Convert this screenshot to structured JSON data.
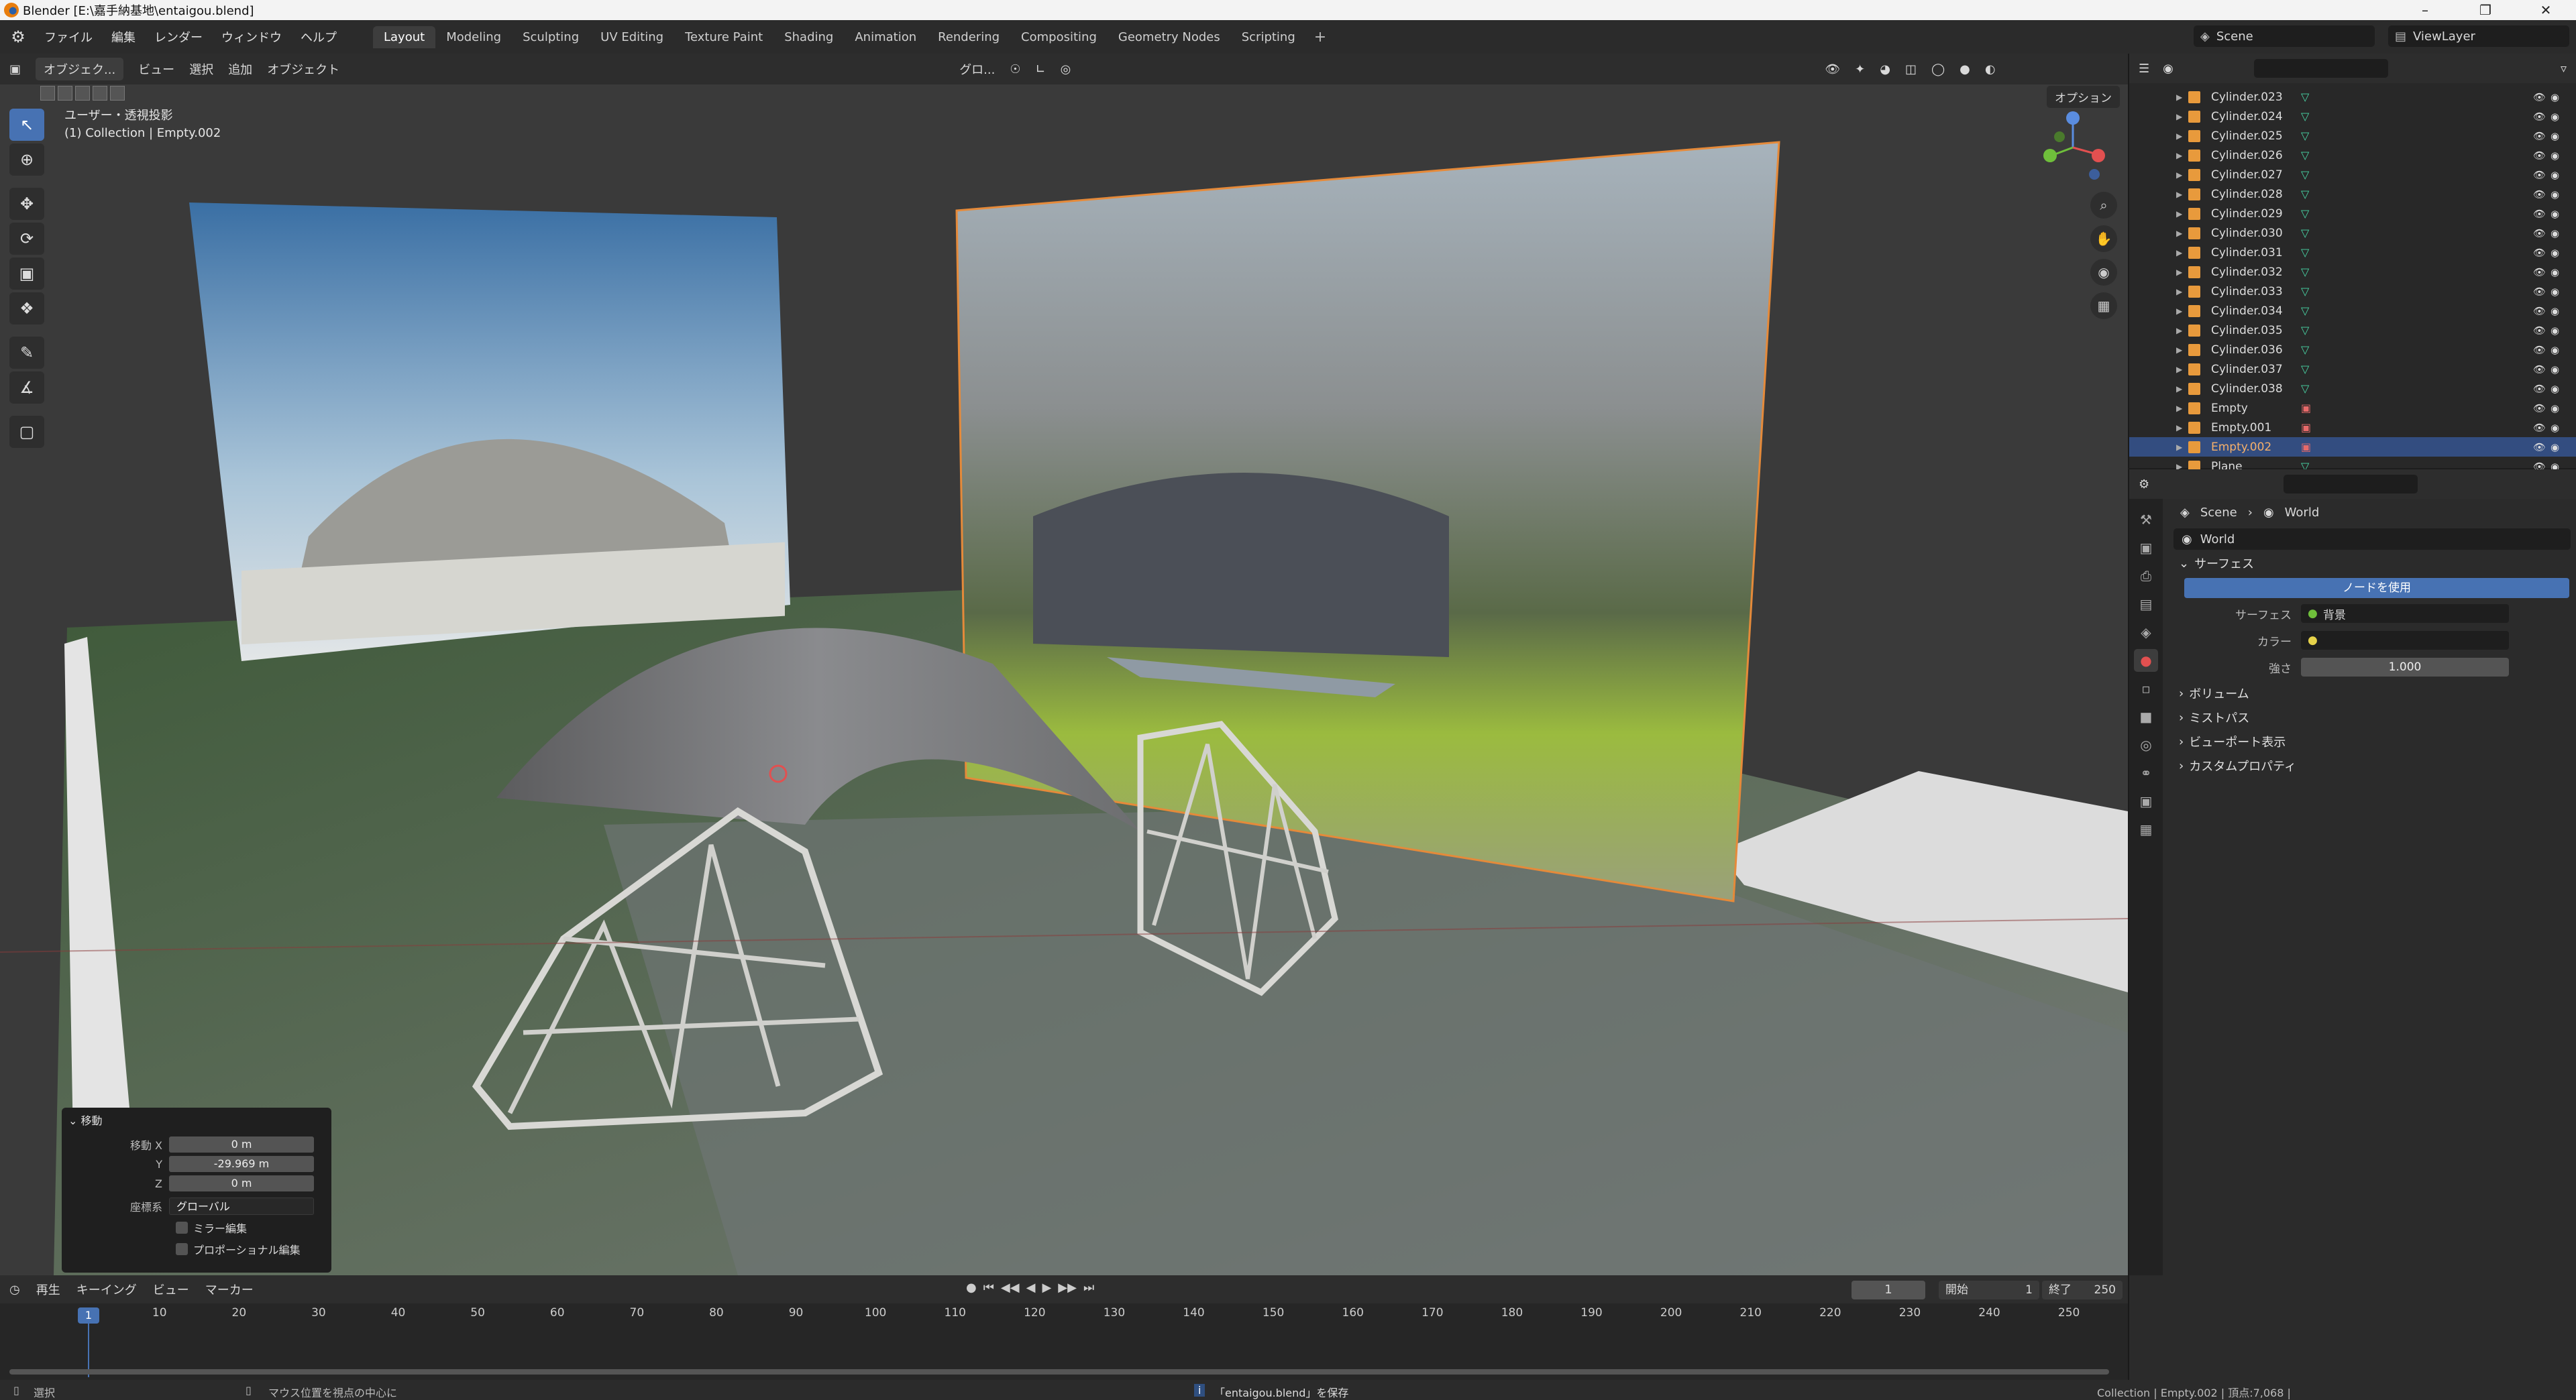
{
  "window": {
    "title": "Blender [E:\\嘉手納基地\\entaigou.blend]"
  },
  "topbar": {
    "menus": [
      "ファイル",
      "編集",
      "レンダー",
      "ウィンドウ",
      "ヘルプ"
    ],
    "workspaces": [
      "Layout",
      "Modeling",
      "Sculpting",
      "UV Editing",
      "Texture Paint",
      "Shading",
      "Animation",
      "Rendering",
      "Compositing",
      "Geometry Nodes",
      "Scripting"
    ],
    "active_workspace": "Layout",
    "scene": "Scene",
    "view_layer": "ViewLayer"
  },
  "viewport": {
    "mode": "オブジェク...",
    "menus": [
      "ビュー",
      "選択",
      "追加",
      "オブジェクト"
    ],
    "transform_orientation": "グロ...",
    "view_label": "ユーザー・透視投影",
    "context_label": "(1) Collection | Empty.002",
    "options_label": "オプション"
  },
  "redo_panel": {
    "title": "移動",
    "move_x_label": "移動 X",
    "move_x": "0 m",
    "y_label": "Y",
    "y": "-29.969 m",
    "z_label": "Z",
    "z": "0 m",
    "coord_label": "座標系",
    "coord_value": "グローバル",
    "mirror_label": "ミラー編集",
    "proportional_label": "プロポーショナル編集"
  },
  "outliner": {
    "search_placeholder": "",
    "rows": [
      {
        "name": "Cylinder.023",
        "type": "mesh",
        "selected": false
      },
      {
        "name": "Cylinder.024",
        "type": "mesh",
        "selected": false
      },
      {
        "name": "Cylinder.025",
        "type": "mesh",
        "selected": false
      },
      {
        "name": "Cylinder.026",
        "type": "mesh",
        "selected": false
      },
      {
        "name": "Cylinder.027",
        "type": "mesh",
        "selected": false
      },
      {
        "name": "Cylinder.028",
        "type": "mesh",
        "selected": false
      },
      {
        "name": "Cylinder.029",
        "type": "mesh",
        "selected": false
      },
      {
        "name": "Cylinder.030",
        "type": "mesh",
        "selected": false
      },
      {
        "name": "Cylinder.031",
        "type": "mesh",
        "selected": false
      },
      {
        "name": "Cylinder.032",
        "type": "mesh",
        "selected": false
      },
      {
        "name": "Cylinder.033",
        "type": "mesh",
        "selected": false
      },
      {
        "name": "Cylinder.034",
        "type": "mesh",
        "selected": false
      },
      {
        "name": "Cylinder.035",
        "type": "mesh",
        "selected": false
      },
      {
        "name": "Cylinder.036",
        "type": "mesh",
        "selected": false
      },
      {
        "name": "Cylinder.037",
        "type": "mesh",
        "selected": false
      },
      {
        "name": "Cylinder.038",
        "type": "mesh",
        "selected": false
      },
      {
        "name": "Empty",
        "type": "image",
        "selected": false
      },
      {
        "name": "Empty.001",
        "type": "image",
        "selected": false
      },
      {
        "name": "Empty.002",
        "type": "image",
        "selected": true
      },
      {
        "name": "Plane",
        "type": "mesh",
        "selected": false
      }
    ]
  },
  "properties": {
    "breadcrumb_scene": "Scene",
    "breadcrumb_world": "World",
    "world_name": "World",
    "surface_panel": "サーフェス",
    "use_nodes_button": "ノードを使用",
    "surface_label": "サーフェス",
    "surface_value": "背景",
    "color_label": "カラー",
    "strength_label": "強さ",
    "strength_value": "1.000",
    "volume_panel": "ボリューム",
    "mist_panel": "ミストパス",
    "viewport_display_panel": "ビューポート表示",
    "custom_props_panel": "カスタムプロパティ"
  },
  "timeline": {
    "menus": [
      "再生",
      "キーイング",
      "ビュー",
      "マーカー"
    ],
    "current_frame": "1",
    "start_label": "開始",
    "start": "1",
    "end_label": "終了",
    "end": "250",
    "ticks": [
      "10",
      "20",
      "30",
      "40",
      "50",
      "60",
      "70",
      "80",
      "90",
      "100",
      "110",
      "120",
      "130",
      "140",
      "150",
      "160",
      "170",
      "180",
      "190",
      "200",
      "210",
      "220",
      "230",
      "240",
      "250"
    ],
    "cursor_label": "1"
  },
  "statusbar": {
    "select": "選択",
    "center_view": "マウス位置を視点の中心に",
    "saved": "「entaigou.blend」を保存",
    "stats": "Collection | Empty.002 | 頂点:7,068 |"
  },
  "colors": {
    "accent": "#4772b3",
    "selected_row": "#334d80",
    "mesh_icon": "#49d6a6",
    "image_icon": "#e86a6a"
  }
}
